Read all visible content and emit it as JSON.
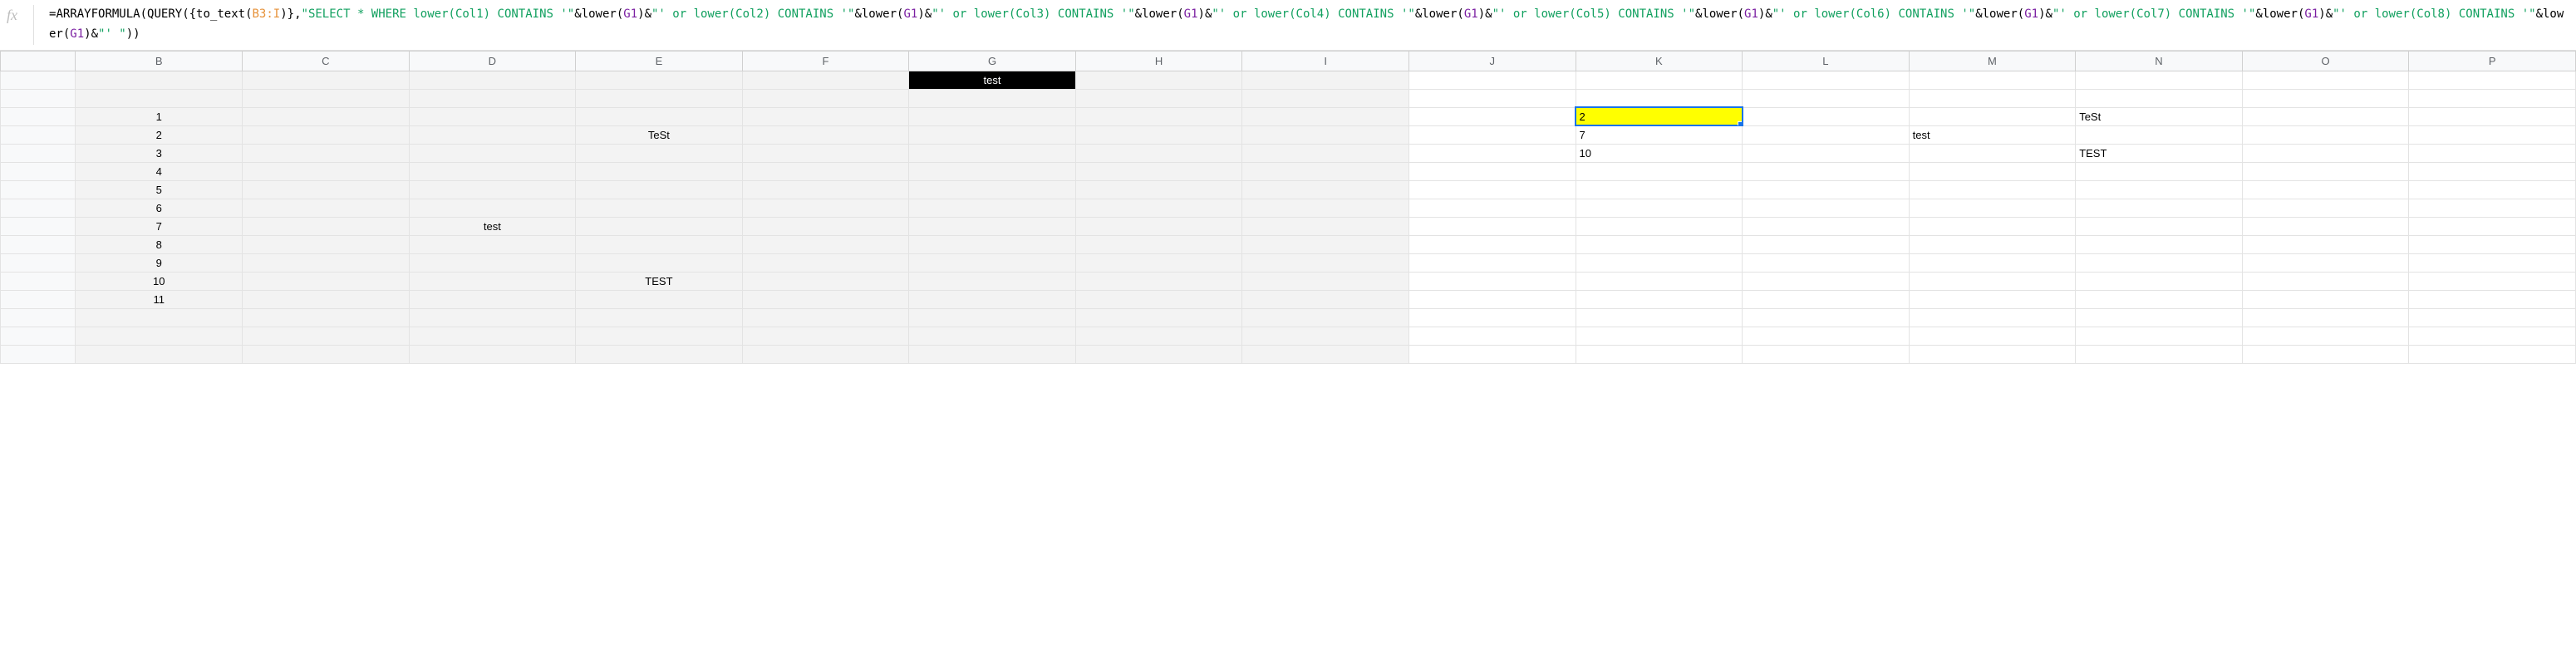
{
  "formula": {
    "segments": [
      {
        "cls": "tok-black",
        "t": "="
      },
      {
        "cls": "tok-black",
        "t": "ARRAYFORMULA"
      },
      {
        "cls": "tok-black",
        "t": "("
      },
      {
        "cls": "tok-black",
        "t": "QUERY"
      },
      {
        "cls": "tok-black",
        "t": "({"
      },
      {
        "cls": "tok-black",
        "t": "to_text"
      },
      {
        "cls": "tok-black",
        "t": "("
      },
      {
        "cls": "tok-orange",
        "t": "B3:I"
      },
      {
        "cls": "tok-black",
        "t": ")},"
      },
      {
        "cls": "tok-green",
        "t": "\"SELECT * WHERE lower(Col1) CONTAINS '\""
      },
      {
        "cls": "tok-black",
        "t": "&"
      },
      {
        "cls": "tok-black",
        "t": "lower"
      },
      {
        "cls": "tok-black",
        "t": "("
      },
      {
        "cls": "tok-purple",
        "t": "G1"
      },
      {
        "cls": "tok-black",
        "t": ")&"
      },
      {
        "cls": "tok-green",
        "t": "\"' or lower(Col2) CONTAINS '\""
      },
      {
        "cls": "tok-black",
        "t": "&"
      },
      {
        "cls": "tok-black",
        "t": "lower"
      },
      {
        "cls": "tok-black",
        "t": "("
      },
      {
        "cls": "tok-purple",
        "t": "G1"
      },
      {
        "cls": "tok-black",
        "t": ")&"
      },
      {
        "cls": "tok-green",
        "t": "\"' or lower(Col3) CONTAINS '\""
      },
      {
        "cls": "tok-black",
        "t": "&"
      },
      {
        "cls": "tok-black",
        "t": "lower"
      },
      {
        "cls": "tok-black",
        "t": "("
      },
      {
        "cls": "tok-purple",
        "t": "G1"
      },
      {
        "cls": "tok-black",
        "t": ")&"
      },
      {
        "cls": "tok-green",
        "t": "\"' or lower(Col4) CONTAINS '\""
      },
      {
        "cls": "tok-black",
        "t": "&"
      },
      {
        "cls": "tok-black",
        "t": "lower"
      },
      {
        "cls": "tok-black",
        "t": "("
      },
      {
        "cls": "tok-purple",
        "t": "G1"
      },
      {
        "cls": "tok-black",
        "t": ")&"
      },
      {
        "cls": "tok-green",
        "t": "\"' or lower(Col5) CONTAINS '\""
      },
      {
        "cls": "tok-black",
        "t": "&"
      },
      {
        "cls": "tok-black",
        "t": "lower"
      },
      {
        "cls": "tok-black",
        "t": "("
      },
      {
        "cls": "tok-purple",
        "t": "G1"
      },
      {
        "cls": "tok-black",
        "t": ")&"
      },
      {
        "cls": "tok-green",
        "t": "\"' or lower(Col6) CONTAINS '\""
      },
      {
        "cls": "tok-black",
        "t": "&"
      },
      {
        "cls": "tok-black",
        "t": "lower"
      },
      {
        "cls": "tok-black",
        "t": "("
      },
      {
        "cls": "tok-purple",
        "t": "G1"
      },
      {
        "cls": "tok-black",
        "t": ")&"
      },
      {
        "cls": "tok-green",
        "t": "\"' or lower(Col7) CONTAINS '\""
      },
      {
        "cls": "tok-black",
        "t": "&"
      },
      {
        "cls": "tok-black",
        "t": "lower"
      },
      {
        "cls": "tok-black",
        "t": "("
      },
      {
        "cls": "tok-purple",
        "t": "G1"
      },
      {
        "cls": "tok-black",
        "t": ")&"
      },
      {
        "cls": "tok-green",
        "t": "\"' or lower(Col8) CONTAINS '\""
      },
      {
        "cls": "tok-black",
        "t": "&"
      },
      {
        "cls": "tok-black",
        "t": "lower"
      },
      {
        "cls": "tok-black",
        "t": "("
      },
      {
        "cls": "tok-purple",
        "t": "G1"
      },
      {
        "cls": "tok-black",
        "t": ")&"
      },
      {
        "cls": "tok-green",
        "t": "\"' \""
      },
      {
        "cls": "tok-black",
        "t": "))"
      }
    ]
  },
  "columns": [
    "B",
    "C",
    "D",
    "E",
    "F",
    "G",
    "H",
    "I",
    "J",
    "K",
    "L",
    "M",
    "N",
    "O",
    "P"
  ],
  "rows": [
    {
      "cells": {
        "G": {
          "v": "test",
          "cls": "black-cell"
        }
      }
    },
    {
      "cells": {}
    },
    {
      "cells": {
        "B": {
          "v": "1",
          "cls": "center"
        },
        "K": {
          "v": "2",
          "active": true
        },
        "N": {
          "v": "TeSt"
        }
      }
    },
    {
      "cells": {
        "B": {
          "v": "2",
          "cls": "center"
        },
        "E": {
          "v": "TeSt",
          "cls": "center"
        },
        "K": {
          "v": "7"
        },
        "M": {
          "v": "test"
        }
      }
    },
    {
      "cells": {
        "B": {
          "v": "3",
          "cls": "center"
        },
        "K": {
          "v": "10"
        },
        "N": {
          "v": "TEST"
        }
      }
    },
    {
      "cells": {
        "B": {
          "v": "4",
          "cls": "center"
        }
      }
    },
    {
      "cells": {
        "B": {
          "v": "5",
          "cls": "center"
        }
      }
    },
    {
      "cells": {
        "B": {
          "v": "6",
          "cls": "center"
        }
      }
    },
    {
      "cells": {
        "B": {
          "v": "7",
          "cls": "center"
        },
        "D": {
          "v": "test",
          "cls": "center"
        }
      }
    },
    {
      "cells": {
        "B": {
          "v": "8",
          "cls": "center"
        }
      }
    },
    {
      "cells": {
        "B": {
          "v": "9",
          "cls": "center"
        }
      }
    },
    {
      "cells": {
        "B": {
          "v": "10",
          "cls": "center"
        },
        "E": {
          "v": "TEST",
          "cls": "center"
        }
      }
    },
    {
      "cells": {
        "B": {
          "v": "11",
          "cls": "center"
        }
      }
    },
    {
      "cells": {}
    },
    {
      "cells": {}
    },
    {
      "cells": {}
    }
  ],
  "shadedColumns": [
    "B",
    "C",
    "D",
    "E",
    "F",
    "G",
    "H",
    "I"
  ]
}
